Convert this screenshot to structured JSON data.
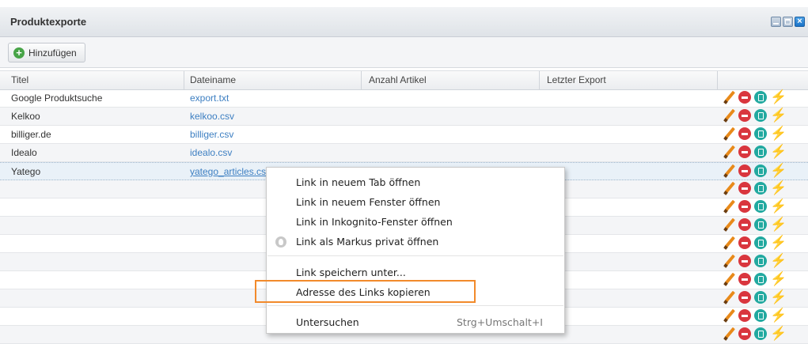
{
  "window": {
    "title": "Produktexporte"
  },
  "toolbar": {
    "add_label": "Hinzufügen"
  },
  "table": {
    "columns": [
      "Titel",
      "Dateiname",
      "Anzahl Artikel",
      "Letzter Export"
    ],
    "rows": [
      {
        "title": "Google Produktsuche",
        "file": "export.txt"
      },
      {
        "title": "Kelkoo",
        "file": "kelkoo.csv"
      },
      {
        "title": "billiger.de",
        "file": "billiger.csv"
      },
      {
        "title": "Idealo",
        "file": "idealo.csv"
      },
      {
        "title": "Yatego",
        "file": "yatego_articles.cs"
      }
    ],
    "partial_count": "0"
  },
  "context_menu": {
    "items": [
      "Link in neuem Tab öffnen",
      "Link in neuem Fenster öffnen",
      "Link in Inkognito-Fenster öffnen",
      "Link als Markus privat öffnen",
      "Link speichern unter...",
      "Adresse des Links kopieren",
      "Untersuchen"
    ],
    "inspect_shortcut": "Strg+Umschalt+I"
  },
  "colors": {
    "link": "#3d7fc2",
    "highlight": "#f28a2b",
    "add_icon": "#47a447"
  },
  "row_icons": [
    "pencil-icon",
    "delete-icon",
    "duplicate-icon",
    "export-bolt-icon"
  ]
}
